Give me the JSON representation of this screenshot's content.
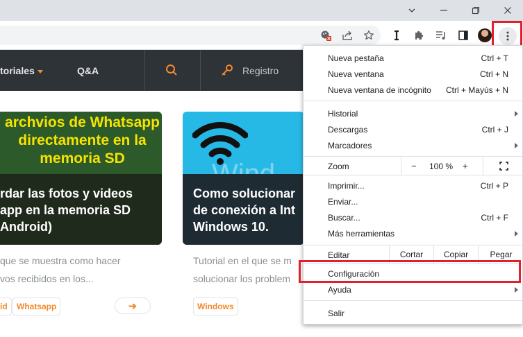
{
  "window": {
    "minimize_icon": "minimize-icon",
    "restore_icon": "restore-icon",
    "close_icon": "close-icon",
    "tab_dropdown_icon": "chevron-down-icon"
  },
  "toolbar": {
    "icons": [
      "tracking-blocked-icon",
      "share-icon",
      "bookmark-star-icon",
      "extension-i-icon",
      "puzzle-icon",
      "reading-list-icon",
      "side-panel-icon"
    ],
    "avatar_icon": "profile-avatar",
    "menu_icon": "more-vert-icon"
  },
  "site": {
    "nav": {
      "tutoriales": "toriales",
      "qa": "Q&A",
      "registro": "Registro"
    },
    "card1": {
      "image_text": [
        "archvios de Whatsapp",
        "directamente en la",
        "memoria SD"
      ],
      "title_lines": [
        "rdar las fotos y videos",
        "app en la memoria SD",
        "Android)"
      ]
    },
    "card2": {
      "image_text": "Wind",
      "title_lines": [
        "Como solucionar",
        "de conexión a Int",
        "Windows 10."
      ]
    },
    "excerpt1": [
      "que se muestra como hacer",
      "vos recibidos en los..."
    ],
    "excerpt2": [
      "Tutorial en el que se m",
      "solucionar los problem"
    ],
    "tags": [
      "id",
      "Whatsapp",
      "Windows"
    ],
    "arrow": "➔"
  },
  "menu": {
    "items_group1": [
      {
        "label": "Nueva pestaña",
        "shortcut": "Ctrl + T"
      },
      {
        "label": "Nueva ventana",
        "shortcut": "Ctrl + N"
      },
      {
        "label": "Nueva ventana de incógnito",
        "shortcut": "Ctrl + Mayús + N"
      }
    ],
    "items_group2": [
      {
        "label": "Historial",
        "shortcut": ""
      },
      {
        "label": "Descargas",
        "shortcut": "Ctrl + J"
      },
      {
        "label": "Marcadores",
        "shortcut": ""
      }
    ],
    "zoom": {
      "label": "Zoom",
      "minus": "−",
      "value": "100 %",
      "plus": "+",
      "fullscreen_icon": "fullscreen-icon"
    },
    "items_group3": [
      {
        "label": "Imprimir...",
        "shortcut": "Ctrl + P"
      },
      {
        "label": "Enviar...",
        "shortcut": ""
      },
      {
        "label": "Buscar...",
        "shortcut": "Ctrl + F"
      },
      {
        "label": "Más herramientas",
        "shortcut": ""
      }
    ],
    "edit": {
      "label": "Editar",
      "cut": "Cortar",
      "copy": "Copiar",
      "paste": "Pegar"
    },
    "items_group4": [
      {
        "label": "Configuración",
        "shortcut": ""
      },
      {
        "label": "Ayuda",
        "shortcut": ""
      }
    ],
    "exit": "Salir"
  },
  "colors": {
    "highlight": "#e0202a",
    "accent_orange": "#f28a2b",
    "nav_bg": "#2e3338"
  }
}
